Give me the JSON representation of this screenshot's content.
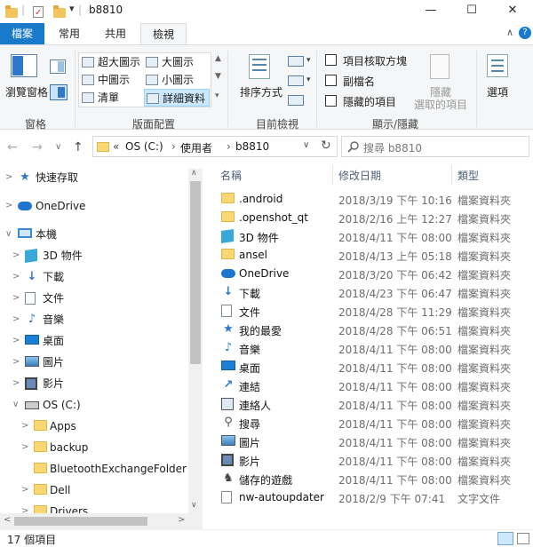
{
  "window": {
    "title": "b8810",
    "minimize_symbol": "—",
    "maximize_symbol": "☐",
    "close_symbol": "✕",
    "qa_dropdown_symbol": "▾",
    "qa_separator": "|"
  },
  "tabs": [
    "檔案",
    "常用",
    "共用",
    "檢視"
  ],
  "ribbon": {
    "collapse_symbol": "∧",
    "help_symbol": "?",
    "panes": {
      "preview_pane_label": "瀏覽窗格",
      "group_label": "窗格"
    },
    "layout": {
      "items": [
        "超大圖示",
        "大圖示",
        "中圖示",
        "小圖示",
        "清單",
        "詳細資料"
      ],
      "selected": "詳細資料",
      "group_label": "版面配置"
    },
    "current_view": {
      "sort_label": "排序方式",
      "group_label": "目前檢視"
    },
    "show_hide": {
      "options": [
        {
          "label": "項目核取方塊",
          "checked": false
        },
        {
          "label": "副檔名",
          "checked": false
        },
        {
          "label": "隱藏的項目",
          "checked": false
        }
      ],
      "hide_selected_line1": "隱藏",
      "hide_selected_line2": "選取的項目",
      "options_label": "選項",
      "group_label": "顯示/隱藏"
    }
  },
  "address": {
    "back_symbol": "←",
    "forward_symbol": "→",
    "recent_symbol": "∨",
    "up_symbol": "↑",
    "overflow": "«",
    "breadcrumbs": [
      "OS (C:)",
      "使用者",
      "b8810"
    ],
    "separator": "›",
    "dropdown_symbol": "∨",
    "refresh_symbol": "↻",
    "search_placeholder": "搜尋 b8810",
    "search_icon": "search-icon"
  },
  "sidebar": {
    "items": [
      {
        "label": "快速存取",
        "icon": "star-icon",
        "level": 0,
        "expand": ">"
      },
      {
        "label": "OneDrive",
        "icon": "cloud-icon",
        "level": 0,
        "expand": ">"
      },
      {
        "label": "本機",
        "icon": "pc-icon",
        "level": 0,
        "expand": "∨"
      },
      {
        "label": "3D 物件",
        "icon": "3d-icon",
        "level": 1,
        "expand": ">"
      },
      {
        "label": "下載",
        "icon": "download-icon",
        "level": 1,
        "expand": ">"
      },
      {
        "label": "文件",
        "icon": "document-icon",
        "level": 1,
        "expand": ">"
      },
      {
        "label": "音樂",
        "icon": "music-icon",
        "level": 1,
        "expand": ">"
      },
      {
        "label": "桌面",
        "icon": "desktop-icon",
        "level": 1,
        "expand": ">"
      },
      {
        "label": "圖片",
        "icon": "pictures-icon",
        "level": 1,
        "expand": ">"
      },
      {
        "label": "影片",
        "icon": "video-icon",
        "level": 1,
        "expand": ">"
      },
      {
        "label": "OS (C:)",
        "icon": "drive-icon",
        "level": 1,
        "expand": "∨"
      },
      {
        "label": "Apps",
        "icon": "folder-icon",
        "level": 2,
        "expand": ">"
      },
      {
        "label": "backup",
        "icon": "folder-icon",
        "level": 2,
        "expand": ">"
      },
      {
        "label": "BluetoothExchangeFolder",
        "icon": "folder-icon",
        "level": 2,
        "expand": ""
      },
      {
        "label": "Dell",
        "icon": "folder-icon",
        "level": 2,
        "expand": ">"
      },
      {
        "label": "Drivers",
        "icon": "folder-icon",
        "level": 2,
        "expand": ">"
      }
    ],
    "scroll_up": "∧",
    "scroll_down": "∨",
    "scroll_left": "<",
    "scroll_right": ">"
  },
  "columns": {
    "name": "名稱",
    "modified": "修改日期",
    "type": "類型",
    "sort_symbol": "^"
  },
  "files": [
    {
      "name": ".android",
      "date": "2018/3/19 下午 10:16",
      "type": "檔案資料夾",
      "icon": "folder-icon"
    },
    {
      "name": ".openshot_qt",
      "date": "2018/2/16 上午 12:27",
      "type": "檔案資料夾",
      "icon": "folder-icon"
    },
    {
      "name": "3D 物件",
      "date": "2018/4/11 下午 08:00",
      "type": "檔案資料夾",
      "icon": "3d-icon"
    },
    {
      "name": "ansel",
      "date": "2018/4/13 上午 05:18",
      "type": "檔案資料夾",
      "icon": "folder-icon"
    },
    {
      "name": "OneDrive",
      "date": "2018/3/20 下午 06:42",
      "type": "檔案資料夾",
      "icon": "cloud-icon"
    },
    {
      "name": "下載",
      "date": "2018/4/23 下午 06:47",
      "type": "檔案資料夾",
      "icon": "download-icon"
    },
    {
      "name": "文件",
      "date": "2018/4/28 下午 11:29",
      "type": "檔案資料夾",
      "icon": "document-icon"
    },
    {
      "name": "我的最愛",
      "date": "2018/4/28 下午 06:51",
      "type": "檔案資料夾",
      "icon": "star-icon"
    },
    {
      "name": "音樂",
      "date": "2018/4/11 下午 08:00",
      "type": "檔案資料夾",
      "icon": "music-icon"
    },
    {
      "name": "桌面",
      "date": "2018/4/11 下午 08:00",
      "type": "檔案資料夾",
      "icon": "desktop-icon"
    },
    {
      "name": "連結",
      "date": "2018/4/11 下午 08:00",
      "type": "檔案資料夾",
      "icon": "link-icon"
    },
    {
      "name": "連絡人",
      "date": "2018/4/11 下午 08:00",
      "type": "檔案資料夾",
      "icon": "contacts-icon"
    },
    {
      "name": "搜尋",
      "date": "2018/4/11 下午 08:00",
      "type": "檔案資料夾",
      "icon": "search-icon"
    },
    {
      "name": "圖片",
      "date": "2018/4/11 下午 08:00",
      "type": "檔案資料夾",
      "icon": "pictures-icon"
    },
    {
      "name": "影片",
      "date": "2018/4/11 下午 08:00",
      "type": "檔案資料夾",
      "icon": "video-icon"
    },
    {
      "name": "儲存的遊戲",
      "date": "2018/4/11 下午 08:00",
      "type": "檔案資料夾",
      "icon": "games-icon"
    },
    {
      "name": "nw-autoupdater",
      "date": "2018/2/9 下午 07:41",
      "type": "文字文件",
      "icon": "text-file-icon"
    }
  ],
  "status": {
    "count_text": "17 個項目"
  },
  "colors": {
    "accent": "#1979ca",
    "folder": "#f8d775",
    "ribbon_bg": "#f5f6f7"
  }
}
